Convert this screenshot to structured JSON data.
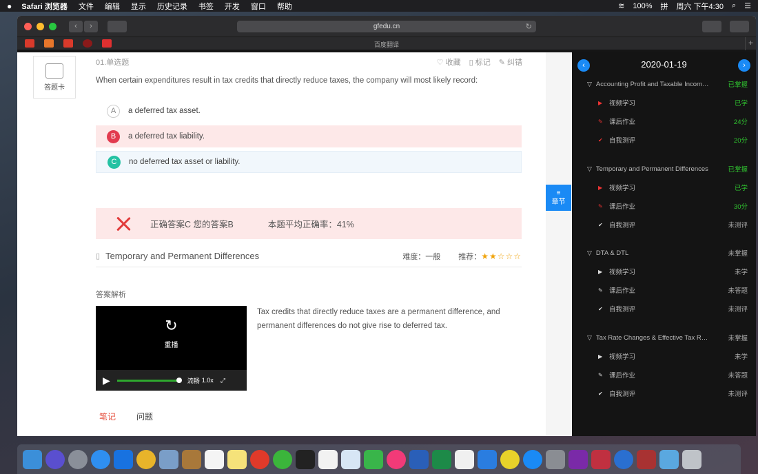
{
  "menubar": {
    "apple": "",
    "app": "Safari 浏览器",
    "menus": [
      "文件",
      "编辑",
      "显示",
      "历史记录",
      "书签",
      "开发",
      "窗口",
      "帮助"
    ],
    "battery": "100%",
    "input": "拼",
    "clock": "周六 下午4:30"
  },
  "browser": {
    "url": "gfedu.cn",
    "bookmark_center": "百度翻译",
    "colors": {
      "close": "#ff5f57",
      "min": "#febc2e",
      "max": "#28c840"
    }
  },
  "question": {
    "card_label": "答题卡",
    "type": "01.单选题",
    "actions": {
      "fav": "收藏",
      "mark": "标记",
      "error": "纠错"
    },
    "text": "When certain expenditures result in tax credits that directly reduce taxes, the company will most likely record:",
    "options": [
      {
        "letter": "A",
        "text": "a deferred tax asset."
      },
      {
        "letter": "B",
        "text": "a deferred tax liability."
      },
      {
        "letter": "C",
        "text": "no deferred tax asset or liability."
      }
    ],
    "result": "正确答案C 您的答案B",
    "accuracy": "本题平均正确率：41%",
    "topic": "Temporary and Permanent Differences",
    "difficulty": "难度：一般",
    "recommend": "推荐：",
    "stars": "★★☆☆☆",
    "analysis_label": "答案解析",
    "video": {
      "replay": "重播",
      "quality": "流畅",
      "speed": "1.0x"
    },
    "explanation": "Tax credits that directly reduce taxes are a permanent difference, and permanent differences do not give rise to deferred tax.",
    "tabs": [
      "笔记",
      "问题"
    ]
  },
  "chapter_button": {
    "icon": "≡",
    "label": "章节"
  },
  "panel": {
    "date": "2020-01-19",
    "sections": [
      {
        "title": "Accounting Profit and Taxable Incom…",
        "status": "已掌握",
        "status_color": "green",
        "items": [
          {
            "label": "视频学习",
            "status": "已学",
            "color": "green"
          },
          {
            "label": "课后作业",
            "status": "24分",
            "color": "green"
          },
          {
            "label": "自我测评",
            "status": "20分",
            "color": "green"
          }
        ]
      },
      {
        "title": "Temporary and Permanent Differences",
        "status": "已掌握",
        "status_color": "green",
        "items": [
          {
            "label": "视频学习",
            "status": "已学",
            "color": "green"
          },
          {
            "label": "课后作业",
            "status": "30分",
            "color": "green"
          },
          {
            "label": "自我测评",
            "status": "未测评",
            "color": "grey"
          }
        ]
      },
      {
        "title": "DTA & DTL",
        "status": "未掌握",
        "status_color": "grey",
        "items": [
          {
            "label": "视频学习",
            "status": "未学",
            "color": "grey"
          },
          {
            "label": "课后作业",
            "status": "未答题",
            "color": "grey"
          },
          {
            "label": "自我测评",
            "status": "未测评",
            "color": "grey"
          }
        ]
      },
      {
        "title": "Tax Rate Changes & Effective Tax R…",
        "status": "未掌握",
        "status_color": "grey",
        "items": [
          {
            "label": "视频学习",
            "status": "未学",
            "color": "grey"
          },
          {
            "label": "课后作业",
            "status": "未答题",
            "color": "grey"
          },
          {
            "label": "自我测评",
            "status": "未测评",
            "color": "grey"
          }
        ]
      }
    ]
  }
}
